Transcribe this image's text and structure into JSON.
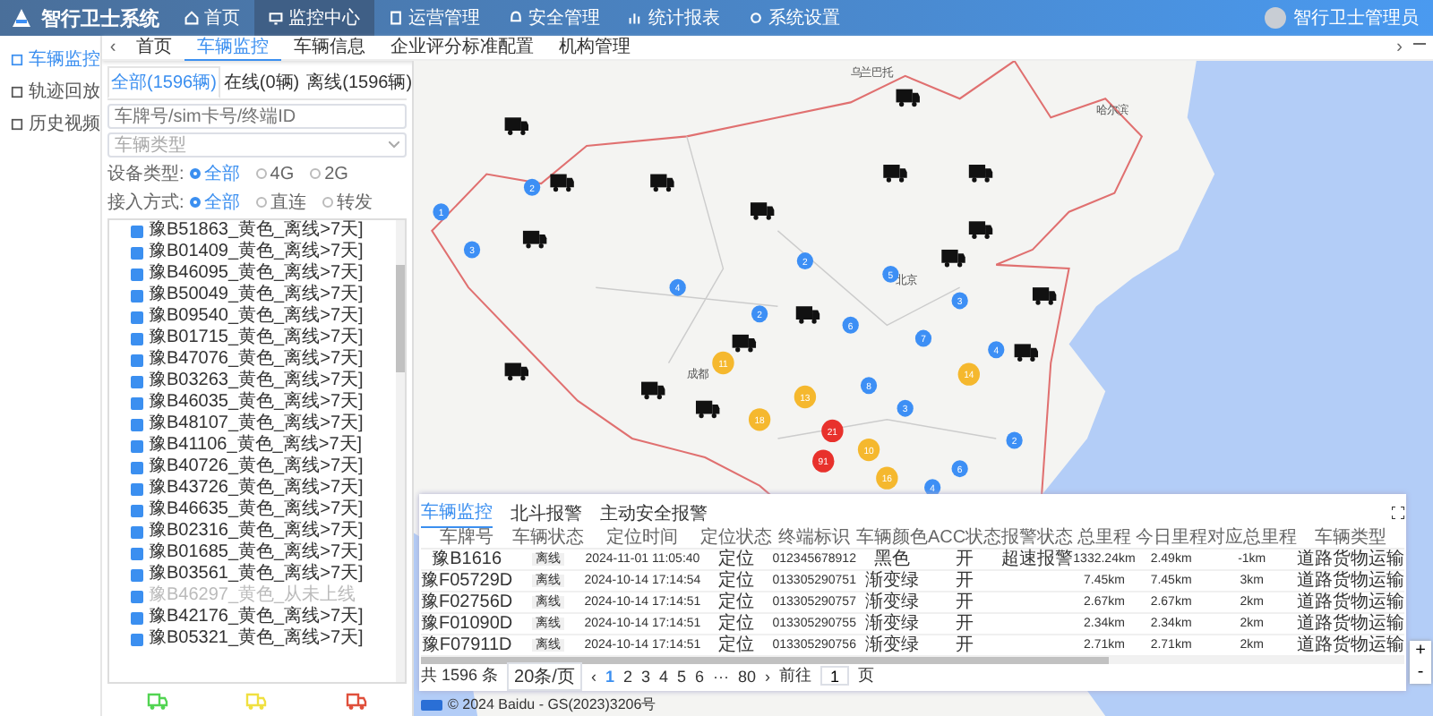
{
  "header": {
    "app_title": "智行卫士系统",
    "nav": [
      {
        "label": "首页",
        "selected": false
      },
      {
        "label": "监控中心",
        "selected": true
      },
      {
        "label": "运营管理",
        "selected": false
      },
      {
        "label": "安全管理",
        "selected": false
      },
      {
        "label": "统计报表",
        "selected": false
      },
      {
        "label": "系统设置",
        "selected": false
      }
    ],
    "user": "智行卫士管理员"
  },
  "sidebar": {
    "items": [
      {
        "label": "车辆监控",
        "selected": true
      },
      {
        "label": "轨迹回放",
        "selected": false
      },
      {
        "label": "历史视频",
        "selected": false
      }
    ]
  },
  "page_tabs": {
    "prev": "‹",
    "next": "›",
    "items": [
      {
        "label": "首页",
        "selected": false
      },
      {
        "label": "车辆监控",
        "selected": true
      },
      {
        "label": "车辆信息",
        "selected": false
      },
      {
        "label": "企业评分标准配置",
        "selected": false
      },
      {
        "label": "机构管理",
        "selected": false
      }
    ]
  },
  "vehicle_panel": {
    "tabs": [
      {
        "label": "全部(1596辆)",
        "selected": true
      },
      {
        "label": "在线(0辆)",
        "selected": false
      },
      {
        "label": "离线(1596辆)",
        "selected": false
      }
    ],
    "search": {
      "placeholder": "车牌号/sim卡号/终端ID"
    },
    "type_select": {
      "placeholder": "车辆类型"
    },
    "filters": [
      {
        "label": "设备类型:",
        "options": [
          {
            "label": "全部",
            "selected": true
          },
          {
            "label": "4G",
            "selected": false
          },
          {
            "label": "2G",
            "selected": false
          }
        ]
      },
      {
        "label": "接入方式:",
        "options": [
          {
            "label": "全部",
            "selected": true
          },
          {
            "label": "直连",
            "selected": false
          },
          {
            "label": "转发",
            "selected": false
          }
        ]
      }
    ],
    "vehicles": [
      {
        "label": "豫B51863_黄色_离线>7天]",
        "checked": true,
        "greyed": false
      },
      {
        "label": "豫B01409_黄色_离线>7天]",
        "checked": true,
        "greyed": false
      },
      {
        "label": "豫B46095_黄色_离线>7天]",
        "checked": true,
        "greyed": false
      },
      {
        "label": "豫B50049_黄色_离线>7天]",
        "checked": true,
        "greyed": false
      },
      {
        "label": "豫B09540_黄色_离线>7天]",
        "checked": true,
        "greyed": false
      },
      {
        "label": "豫B01715_黄色_离线>7天]",
        "checked": true,
        "greyed": false
      },
      {
        "label": "豫B47076_黄色_离线>7天]",
        "checked": true,
        "greyed": false
      },
      {
        "label": "豫B03263_黄色_离线>7天]",
        "checked": true,
        "greyed": false
      },
      {
        "label": "豫B46035_黄色_离线>7天]",
        "checked": true,
        "greyed": false
      },
      {
        "label": "豫B48107_黄色_离线>7天]",
        "checked": true,
        "greyed": false
      },
      {
        "label": "豫B41106_黄色_离线>7天]",
        "checked": true,
        "greyed": false
      },
      {
        "label": "豫B40726_黄色_离线>7天]",
        "checked": true,
        "greyed": false
      },
      {
        "label": "豫B43726_黄色_离线>7天]",
        "checked": true,
        "greyed": false
      },
      {
        "label": "豫B46635_黄色_离线>7天]",
        "checked": true,
        "greyed": false
      },
      {
        "label": "豫B02316_黄色_离线>7天]",
        "checked": true,
        "greyed": false
      },
      {
        "label": "豫B01685_黄色_离线>7天]",
        "checked": true,
        "greyed": false
      },
      {
        "label": "豫B03561_黄色_离线>7天]",
        "checked": true,
        "greyed": false
      },
      {
        "label": "豫B46297_黄色_从未上线",
        "checked": true,
        "greyed": true
      },
      {
        "label": "豫B42176_黄色_离线>7天]",
        "checked": true,
        "greyed": false
      },
      {
        "label": "豫B05321_黄色_离线>7天]",
        "checked": true,
        "greyed": false
      }
    ],
    "legend": [
      {
        "color": "#52d452"
      },
      {
        "color": "#f0e040"
      },
      {
        "color": "#e0503c"
      }
    ]
  },
  "map": {
    "places": [
      "乌兰巴托",
      "哈尔滨",
      "北京",
      "成都"
    ],
    "clusters": [
      {
        "count": "2",
        "color": "#3d8ff5"
      },
      {
        "count": "1",
        "color": "#3d8ff5"
      },
      {
        "count": "3",
        "color": "#3d8ff5"
      },
      {
        "count": "2",
        "color": "#3d8ff5"
      },
      {
        "count": "5",
        "color": "#3d8ff5"
      },
      {
        "count": "4",
        "color": "#3d8ff5"
      },
      {
        "count": "3",
        "color": "#3d8ff5"
      },
      {
        "count": "2",
        "color": "#3d8ff5"
      },
      {
        "count": "6",
        "color": "#3d8ff5"
      },
      {
        "count": "7",
        "color": "#3d8ff5"
      },
      {
        "count": "4",
        "color": "#3d8ff5"
      },
      {
        "count": "11",
        "color": "#f5b82e"
      },
      {
        "count": "14",
        "color": "#f5b82e"
      },
      {
        "count": "8",
        "color": "#3d8ff5"
      },
      {
        "count": "13",
        "color": "#f5b82e"
      },
      {
        "count": "3",
        "color": "#3d8ff5"
      },
      {
        "count": "18",
        "color": "#f5b82e"
      },
      {
        "count": "21",
        "color": "#e8312c"
      },
      {
        "count": "2",
        "color": "#3d8ff5"
      },
      {
        "count": "10",
        "color": "#f5b82e"
      },
      {
        "count": "91",
        "color": "#e8312c"
      },
      {
        "count": "6",
        "color": "#3d8ff5"
      },
      {
        "count": "16",
        "color": "#f5b82e"
      },
      {
        "count": "4",
        "color": "#3d8ff5"
      }
    ],
    "zoom_in": "+",
    "zoom_out": "-",
    "copyright": "© 2024 Baidu - GS(2023)3206号"
  },
  "bottom_panel": {
    "tabs": [
      {
        "label": "车辆监控",
        "selected": true
      },
      {
        "label": "北斗报警",
        "selected": false
      },
      {
        "label": "主动安全报警",
        "selected": false
      }
    ],
    "columns": [
      "车牌号",
      "车辆状态",
      "定位时间",
      "定位状态",
      "终端标识",
      "车辆颜色",
      "ACC状态",
      "报警状态",
      "总里程",
      "今日里程",
      "对应总里程",
      "车辆类型"
    ],
    "rows": [
      [
        "豫B1616",
        "离线",
        "2024-11-01 11:05:40",
        "定位",
        "012345678912",
        "黑色",
        "开",
        "超速报警",
        "1332.24km",
        "2.49km",
        "-1km",
        "道路货物运输"
      ],
      [
        "豫F05729D",
        "离线",
        "2024-10-14 17:14:54",
        "定位",
        "013305290751",
        "渐变绿",
        "开",
        "",
        "7.45km",
        "7.45km",
        "3km",
        "道路货物运输"
      ],
      [
        "豫F02756D",
        "离线",
        "2024-10-14 17:14:51",
        "定位",
        "013305290757",
        "渐变绿",
        "开",
        "",
        "2.67km",
        "2.67km",
        "2km",
        "道路货物运输"
      ],
      [
        "豫F01090D",
        "离线",
        "2024-10-14 17:14:51",
        "定位",
        "013305290755",
        "渐变绿",
        "开",
        "",
        "2.34km",
        "2.34km",
        "2km",
        "道路货物运输"
      ],
      [
        "豫F07911D",
        "离线",
        "2024-10-14 17:14:51",
        "定位",
        "013305290756",
        "渐变绿",
        "开",
        "",
        "2.71km",
        "2.71km",
        "2km",
        "道路货物运输"
      ]
    ],
    "pagination": {
      "total": "共 1596 条",
      "page_size": "20条/页",
      "prev": "‹",
      "next": "›",
      "pages": [
        {
          "label": "1",
          "selected": true
        },
        {
          "label": "2",
          "selected": false
        },
        {
          "label": "3",
          "selected": false
        },
        {
          "label": "4",
          "selected": false
        },
        {
          "label": "5",
          "selected": false
        },
        {
          "label": "6",
          "selected": false
        },
        {
          "label": "···",
          "selected": false
        },
        {
          "label": "80",
          "selected": false
        }
      ],
      "goto_label": "前往",
      "goto_value": "1",
      "goto_suffix": "页"
    }
  }
}
